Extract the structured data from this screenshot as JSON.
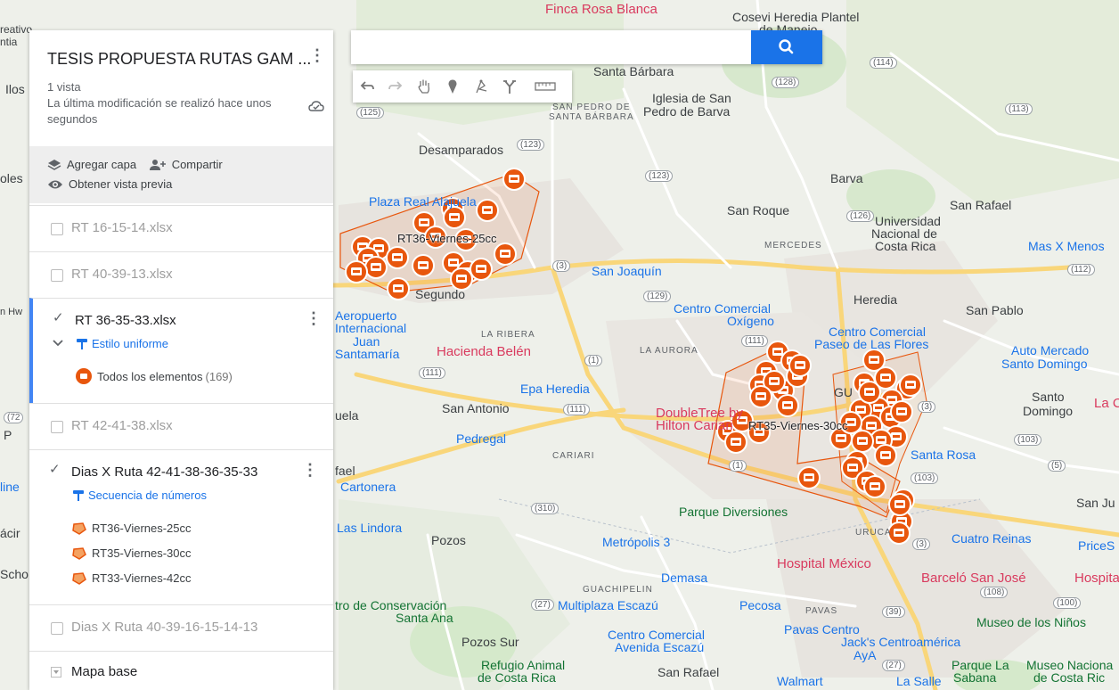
{
  "map": {
    "place_labels": [
      {
        "text": "Finca Rosa Blanca",
        "style": "pink"
      },
      {
        "text": "Cosevi Heredia Plantel",
        "style": "dark"
      },
      {
        "text": "de Manejo",
        "style": "dark"
      },
      {
        "text": "Santa Bárbara",
        "style": "dark"
      },
      {
        "text": "Iglesia de San",
        "style": "dark"
      },
      {
        "text": "Pedro de Barva",
        "style": "dark"
      },
      {
        "text": "SAN PEDRO DE",
        "style": "small"
      },
      {
        "text": "SANTA BÁRBARA",
        "style": "small"
      },
      {
        "text": "Desamparados",
        "style": "dark"
      },
      {
        "text": "Barva",
        "style": "dark"
      },
      {
        "text": "San Rafael",
        "style": "dark"
      },
      {
        "text": "San Roque",
        "style": "dark"
      },
      {
        "text": "Universidad",
        "style": "dark"
      },
      {
        "text": "Nacional de",
        "style": "dark"
      },
      {
        "text": "Costa Rica",
        "style": "dark"
      },
      {
        "text": "Mas X Menos",
        "style": "blue"
      },
      {
        "text": "MERCEDES",
        "style": "small"
      },
      {
        "text": "Plaza Real Alajuela",
        "style": "blue"
      },
      {
        "text": "San Joaquín",
        "style": "blue"
      },
      {
        "text": "Segundo",
        "style": "dark"
      },
      {
        "text": "Heredia",
        "style": "dark"
      },
      {
        "text": "San Pablo",
        "style": "dark"
      },
      {
        "text": "Centro Comercial",
        "style": "blue"
      },
      {
        "text": "Oxígeno",
        "style": "blue"
      },
      {
        "text": "Centro Comercial",
        "style": "blue"
      },
      {
        "text": "Paseo de Las Flores",
        "style": "blue"
      },
      {
        "text": "Aeropuerto",
        "style": "blue"
      },
      {
        "text": "Internacional",
        "style": "blue"
      },
      {
        "text": "Juan",
        "style": "blue"
      },
      {
        "text": "Santamaría",
        "style": "blue"
      },
      {
        "text": "LA RIBERA",
        "style": "small"
      },
      {
        "text": "Hacienda Belén",
        "style": "pink"
      },
      {
        "text": "LA AURORA",
        "style": "small"
      },
      {
        "text": "Auto Mercado",
        "style": "blue"
      },
      {
        "text": "Santo Domingo",
        "style": "blue"
      },
      {
        "text": "Epa Heredia",
        "style": "blue"
      },
      {
        "text": "San Antonio",
        "style": "dark"
      },
      {
        "text": "DoubleTree by",
        "style": "pink"
      },
      {
        "text": "Hilton Cariari",
        "style": "pink"
      },
      {
        "text": "Santo",
        "style": "dark"
      },
      {
        "text": "Domingo",
        "style": "dark"
      },
      {
        "text": "Pedregal",
        "style": "blue"
      },
      {
        "text": "CARIARI",
        "style": "small"
      },
      {
        "text": "Santa Rosa",
        "style": "blue"
      },
      {
        "text": "Cartonera",
        "style": "blue"
      },
      {
        "text": "Parque Diversiones",
        "style": "green"
      },
      {
        "text": "San Ju",
        "style": "dark"
      },
      {
        "text": "Las Lindora",
        "style": "blue"
      },
      {
        "text": "Pozos",
        "style": "dark"
      },
      {
        "text": "Metrópolis 3",
        "style": "blue"
      },
      {
        "text": "URUCA",
        "style": "small"
      },
      {
        "text": "Cuatro Reinas",
        "style": "blue"
      },
      {
        "text": "PriceS",
        "style": "blue"
      },
      {
        "text": "Hospital México",
        "style": "pink"
      },
      {
        "text": "Demasa",
        "style": "blue"
      },
      {
        "text": "Barceló San José",
        "style": "pink"
      },
      {
        "text": "Hospita",
        "style": "pink"
      },
      {
        "text": "GUACHIPELIN",
        "style": "small"
      },
      {
        "text": "Multiplaza Escazú",
        "style": "blue"
      },
      {
        "text": "Pecosa",
        "style": "blue"
      },
      {
        "text": "PAVAS",
        "style": "small"
      },
      {
        "text": "tro de Conservación",
        "style": "green"
      },
      {
        "text": "Santa Ana",
        "style": "green"
      },
      {
        "text": "Pavas Centro",
        "style": "blue"
      },
      {
        "text": "Museo de los Niños",
        "style": "green"
      },
      {
        "text": "Pozos Sur",
        "style": "dark"
      },
      {
        "text": "Centro Comercial",
        "style": "blue"
      },
      {
        "text": "Avenida Escazú",
        "style": "blue"
      },
      {
        "text": "Jack's Centroamérica",
        "style": "blue"
      },
      {
        "text": "AyA",
        "style": "blue"
      },
      {
        "text": "Refugio Animal",
        "style": "green"
      },
      {
        "text": "de Costa Rica",
        "style": "green"
      },
      {
        "text": "San Rafael",
        "style": "dark"
      },
      {
        "text": "Walmart",
        "style": "blue"
      },
      {
        "text": "La Salle",
        "style": "blue"
      },
      {
        "text": "Parque La",
        "style": "green"
      },
      {
        "text": "Sabana",
        "style": "green"
      },
      {
        "text": "Museo Naciona",
        "style": "green"
      },
      {
        "text": "de Costa Ric",
        "style": "green"
      },
      {
        "text": "Ilos",
        "style": "dark"
      },
      {
        "text": "reativo",
        "style": "dark"
      },
      {
        "text": "ntia",
        "style": "dark"
      },
      {
        "text": "oles",
        "style": "dark"
      },
      {
        "text": "n Hw",
        "style": "dark"
      },
      {
        "text": "uela",
        "style": "dark"
      },
      {
        "text": "fael",
        "style": "dark"
      },
      {
        "text": "line",
        "style": "blue"
      },
      {
        "text": "ácir",
        "style": "dark"
      },
      {
        "text": "Scho",
        "style": "dark"
      },
      {
        "text": "GU",
        "style": "dark"
      },
      {
        "text": "La C",
        "style": "pink"
      },
      {
        "text": "P",
        "style": "dark"
      }
    ],
    "road_shields": [
      "(114)",
      "(128)",
      "(125)",
      "(113)",
      "(123)",
      "(123)",
      "(126)",
      "(112)",
      "(3)",
      "(129)",
      "(111)",
      "(111)",
      "(1)",
      "(111)",
      "(103)",
      "(5)",
      "(1)",
      "(103)",
      "(3)",
      "(310)",
      "(3)",
      "(27)",
      "(108)",
      "(100)",
      "(39)",
      "(27)",
      "(72"
    ],
    "overlay_labels": [
      "RT36-Viernes-25cc",
      "RT35-Viernes-30cc"
    ],
    "marker_color": "#e8560d"
  },
  "panel": {
    "title": "TESIS PROPUESTA RUTAS GAM ...",
    "views": "1 vista",
    "modified": "La última modificación se realizó hace unos segundos",
    "add_layer": "Agregar capa",
    "share": "Compartir",
    "preview": "Obtener vista previa",
    "layers": [
      {
        "name": "RT 16-15-14.xlsx",
        "checked": false
      },
      {
        "name": "RT 40-39-13.xlsx",
        "checked": false
      },
      {
        "name": "RT 36-35-33.xlsx",
        "checked": true,
        "style": "Estilo uniforme",
        "item": "Todos los elementos",
        "count": "(169)"
      },
      {
        "name": "RT 42-41-38.xlsx",
        "checked": false
      },
      {
        "name": "Dias X Ruta 42-41-38-36-35-33",
        "checked": true,
        "style": "Secuencia de números",
        "items": [
          "RT36-Viernes-25cc",
          "RT35-Viernes-30cc",
          "RT33-Viernes-42cc"
        ]
      },
      {
        "name": "Dias X Ruta 40-39-16-15-14-13",
        "checked": false
      }
    ],
    "basemap": "Mapa base"
  },
  "search": {
    "value": ""
  },
  "toolbar": {
    "tools": [
      "undo-icon",
      "redo-icon",
      "hand-icon",
      "marker-icon",
      "draw-line-icon",
      "directions-icon",
      "ruler-icon"
    ]
  }
}
